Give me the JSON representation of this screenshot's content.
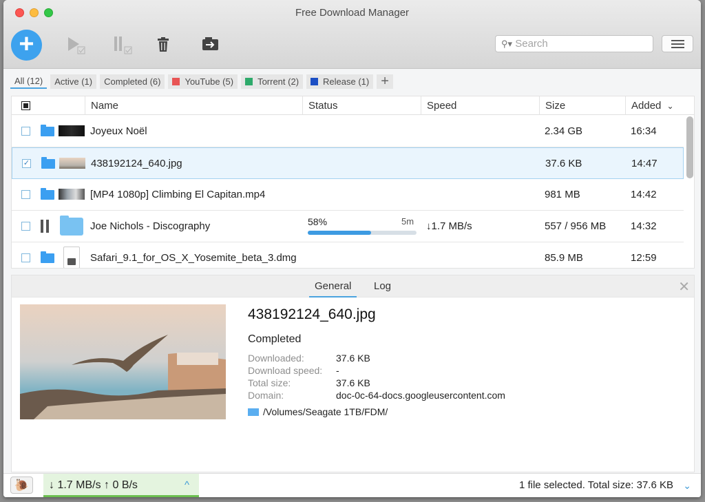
{
  "window": {
    "title": "Free Download Manager"
  },
  "toolbar": {
    "add_label": "+",
    "search_placeholder": "Search"
  },
  "filter_tabs": [
    {
      "label": "All (12)",
      "active": true
    },
    {
      "label": "Active (1)"
    },
    {
      "label": "Completed (6)"
    },
    {
      "label": "YouTube (5)",
      "color": "#e85454"
    },
    {
      "label": "Torrent (2)",
      "color": "#2eaa6b"
    },
    {
      "label": "Release (1)",
      "color": "#1c4fc4"
    }
  ],
  "add_tab_label": "+",
  "columns": {
    "name": "Name",
    "status": "Status",
    "speed": "Speed",
    "size": "Size",
    "added": "Added",
    "sort_indicator": "⌄"
  },
  "rows": [
    {
      "name": "Joyeux Noël",
      "status": "",
      "speed": "",
      "size": "2.34 GB",
      "added": "16:34",
      "checked": false
    },
    {
      "name": "438192124_640.jpg",
      "status": "",
      "speed": "",
      "size": "37.6 KB",
      "added": "14:47",
      "checked": true
    },
    {
      "name": "[MP4 1080p] Climbing El Capitan.mp4",
      "status": "",
      "speed": "",
      "size": "981 MB",
      "added": "14:42",
      "checked": false
    },
    {
      "name": "Joe Nichols - Discography",
      "progress_label": "58%",
      "progress": 0.58,
      "eta": "5m",
      "speed": "↓1.7 MB/s",
      "size": "557 / 956 MB",
      "added": "14:32",
      "checked": false
    },
    {
      "name": "Safari_9.1_for_OS_X_Yosemite_beta_3.dmg",
      "status": "",
      "speed": "",
      "size": "85.9 MB",
      "added": "12:59",
      "checked": false
    }
  ],
  "details": {
    "tabs": [
      "General",
      "Log"
    ],
    "title": "438192124_640.jpg",
    "status": "Completed",
    "fields": [
      {
        "label": "Downloaded:",
        "value": "37.6 KB"
      },
      {
        "label": "Download speed:",
        "value": "-"
      },
      {
        "label": "Total size:",
        "value": "37.6 KB"
      },
      {
        "label": "Domain:",
        "value": "doc-0c-64-docs.googleusercontent.com"
      }
    ],
    "path": "/Volumes/Seagate 1TB/FDM/",
    "close": "✕"
  },
  "statusbar": {
    "speeds": "↓ 1.7 MB/s ↑ 0 B/s",
    "speed_chevron": "^",
    "selection": "1 file selected. Total size: 37.6 KB",
    "selection_chevron": "⌄"
  }
}
